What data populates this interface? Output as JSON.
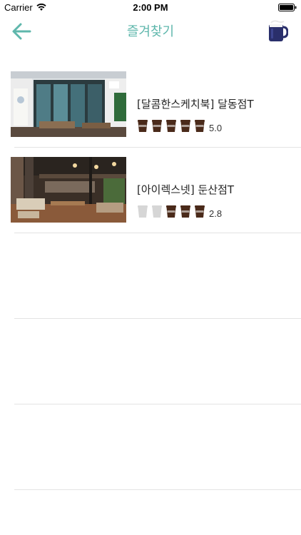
{
  "status_bar": {
    "carrier": "Carrier",
    "time": "2:00 PM"
  },
  "nav": {
    "title": "즐겨찾기",
    "back_icon": "arrow-left-icon",
    "action_icon": "coffee-mug-icon",
    "accent_color": "#5fb7ac"
  },
  "favorites": [
    {
      "name": "[달콤한스케치북] 달동점T",
      "rating": "5.0",
      "filled_cups": 5,
      "total_cups": 5
    },
    {
      "name": "[아이렉스넷] 둔산점T",
      "rating": "2.8",
      "filled_cups": 3,
      "total_cups": 5
    }
  ],
  "colors": {
    "cup_filled": "#4a2a1a",
    "cup_empty": "#d6d6d6",
    "divider": "#e3e3e3"
  }
}
